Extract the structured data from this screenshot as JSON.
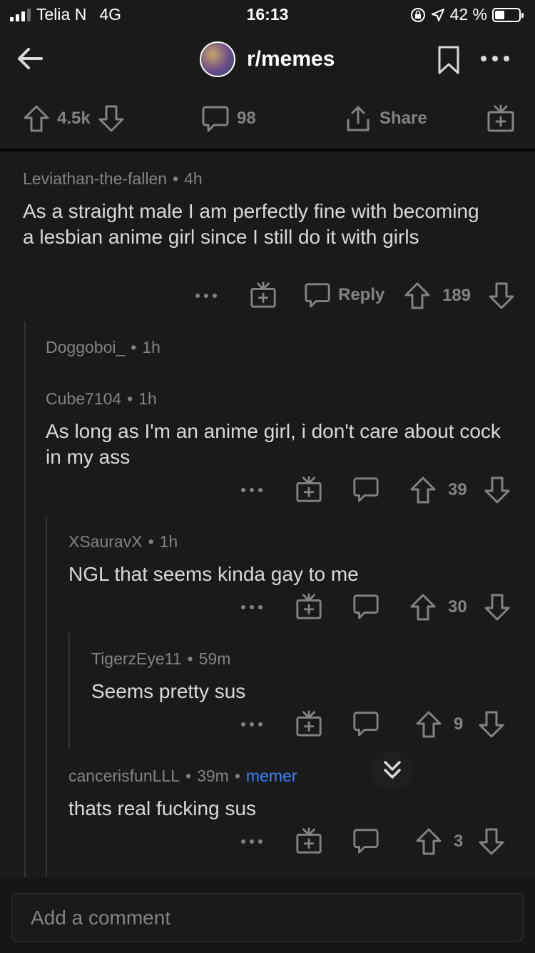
{
  "status": {
    "carrier": "Telia N",
    "network": "4G",
    "time": "16:13",
    "battery": "42 %",
    "battery_level": 0.42
  },
  "header": {
    "subreddit": "r/memes"
  },
  "post_actions": {
    "votes": "4.5k",
    "comments": "98",
    "share": "Share"
  },
  "comments": [
    {
      "author": "Leviathan-the-fallen",
      "age": "4h",
      "text": "As a straight male I am perfectly fine with becoming a lesbian anime girl since I still do it with girls",
      "reply": "Reply",
      "votes": "189"
    },
    {
      "author": "Doggoboi_",
      "age": "1h"
    },
    {
      "author": "Cube7104",
      "age": "1h",
      "text": "As long as I'm an anime girl, i don't care about cock in my ass",
      "votes": "39"
    },
    {
      "author": "XSauravX",
      "age": "1h",
      "text": "NGL that seems kinda gay to me",
      "votes": "30"
    },
    {
      "author": "TigerzEye11",
      "age": "59m",
      "text": "Seems pretty sus",
      "votes": "9"
    },
    {
      "author": "cancerisfunLLL",
      "age": "39m",
      "flair": "memer",
      "text": "thats real fucking sus",
      "votes": "3"
    }
  ],
  "composer": {
    "placeholder": "Add a comment"
  },
  "colors": {
    "background": "#1a1a1b",
    "text": "#d7dadc",
    "muted": "#818384",
    "flair": "#3b82f6"
  }
}
